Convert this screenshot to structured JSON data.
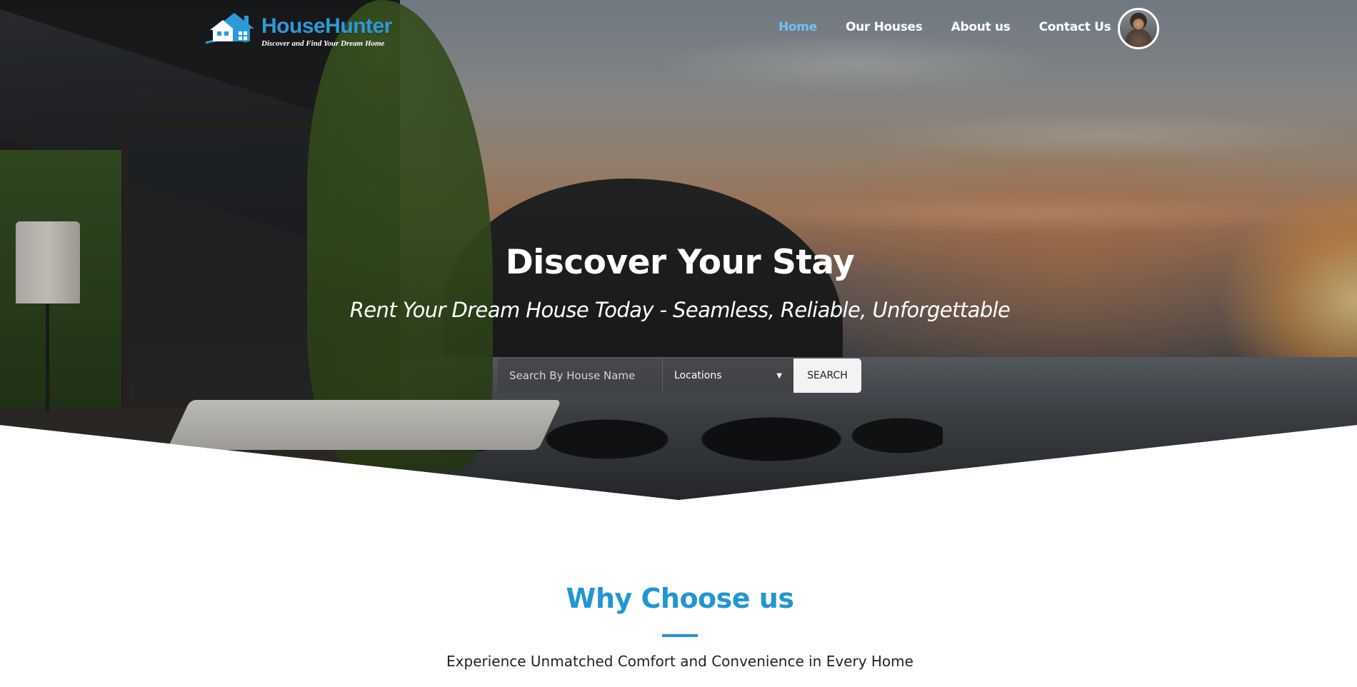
{
  "brand": {
    "name": "HouseHunter",
    "tagline": "Discover and Find Your Dream Home",
    "accent_color": "#2196d3"
  },
  "nav": {
    "items": [
      {
        "label": "Home",
        "active": true
      },
      {
        "label": "Our Houses",
        "active": false
      },
      {
        "label": "About us",
        "active": false
      },
      {
        "label": "Contact Us",
        "active": false
      }
    ],
    "avatar_icon": "user-avatar"
  },
  "hero": {
    "title": "Discover Your Stay",
    "subtitle": "Rent Your Dream House Today - Seamless, Reliable, Unforgettable"
  },
  "search": {
    "placeholder": "Search By House Name",
    "location_selected": "Locations",
    "button_label": "SEARCH"
  },
  "why_section": {
    "title": "Why Choose us",
    "subtitle": "Experience Unmatched Comfort and Convenience in Every Home"
  }
}
